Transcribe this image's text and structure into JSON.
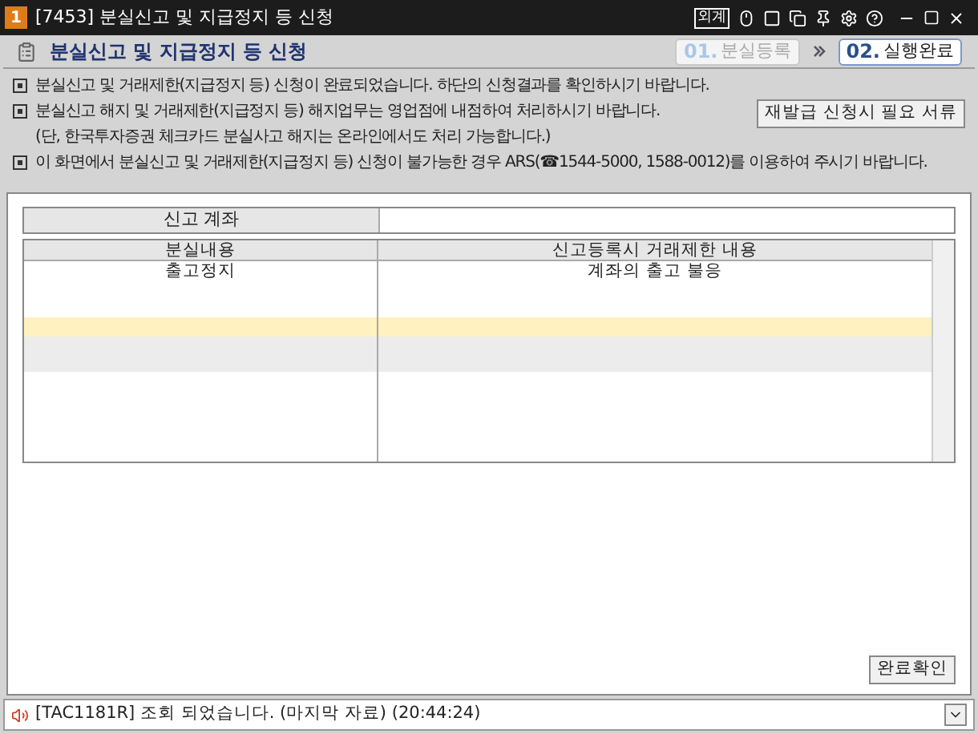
{
  "window": {
    "number": "1",
    "title": "[7453] 분실신고 및 지급정지 등 신청",
    "title_button": "외계"
  },
  "header": {
    "title": "분실신고 및 지급정지 등 신청",
    "steps": [
      {
        "number": "01.",
        "label": "분실등록",
        "selected": false
      },
      {
        "number": "02.",
        "label": "실행완료",
        "selected": true
      }
    ]
  },
  "notices": [
    {
      "kind": "bullet",
      "text": "분실신고 및 거래제한(지급정지 등) 신청이 완료되었습니다. 하단의 신청결과를 확인하시기 바랍니다."
    },
    {
      "kind": "bullet",
      "text": "분실신고 해지 및 거래제한(지급정지 등) 해지업무는 영업점에 내점하여 처리하시기 바랍니다."
    },
    {
      "kind": "indent",
      "text": "(단, 한국투자증권 체크카드 분실사고 해지는 온라인에서도 처리 가능합니다.)"
    },
    {
      "kind": "bullet",
      "text": "이 화면에서 분실신고 및 거래제한(지급정지 등) 신청이 불가능한 경우 ARS(☎1544-5000, 1588-0012)를 이용하여 주시기 바랍니다."
    }
  ],
  "docs_button": "재발급 신청시 필요 서류",
  "account": {
    "label": "신고 계좌"
  },
  "table": {
    "columns": [
      "분실내용",
      "신고등록시 거래제한 내용"
    ],
    "rows": [
      {
        "cells": [
          "출고정지",
          "계좌의 출고 불응"
        ],
        "selected": false
      }
    ]
  },
  "confirm_button": "완료확인",
  "status_bar": {
    "message": "[TAC1181R] 조회 되었습니다. (마지막 자료) (20:44:24)"
  }
}
